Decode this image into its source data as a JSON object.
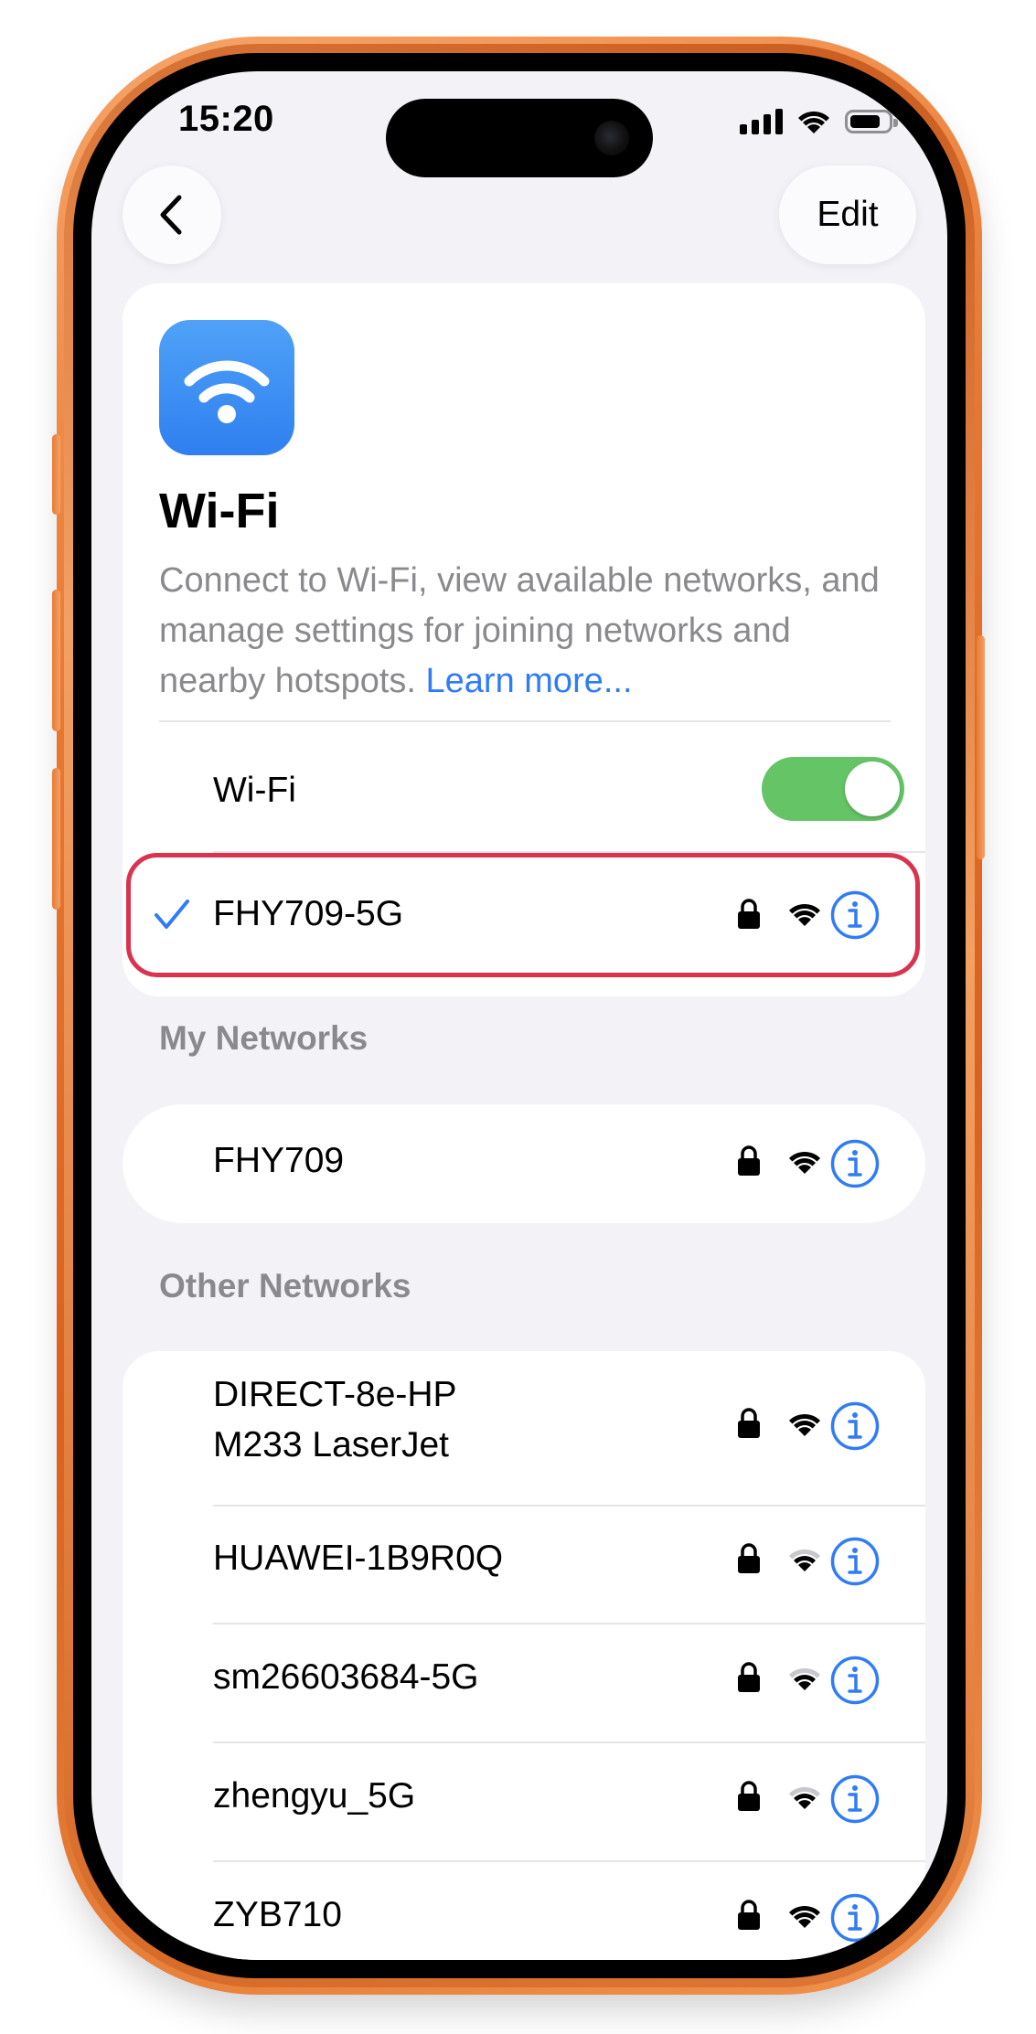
{
  "status_bar": {
    "time": "15:20"
  },
  "nav": {
    "edit_label": "Edit"
  },
  "header": {
    "title": "Wi-Fi",
    "description": "Connect to Wi-Fi, view available networks, and manage settings for joining networks and nearby hotspots.",
    "learn_more": "Learn more..."
  },
  "wifi_toggle": {
    "label": "Wi-Fi",
    "on": true
  },
  "connected_network": {
    "name": "FHY709-5G",
    "secured": true,
    "signal": "full"
  },
  "my_networks": {
    "header": "My Networks",
    "items": [
      {
        "name": "FHY709",
        "secured": true,
        "signal": "full"
      }
    ]
  },
  "other_networks": {
    "header": "Other Networks",
    "items": [
      {
        "name_line1": "DIRECT-8e-HP",
        "name_line2": "M233 LaserJet",
        "secured": true,
        "signal": "full"
      },
      {
        "name": "HUAWEI-1B9R0Q",
        "secured": true,
        "signal": "weak"
      },
      {
        "name": "sm26603684-5G",
        "secured": true,
        "signal": "weak"
      },
      {
        "name": "zhengyu_5G",
        "secured": true,
        "signal": "weak"
      },
      {
        "name": "ZYB710",
        "secured": true,
        "signal": "full"
      }
    ]
  },
  "colors": {
    "accent": "#2f7cf6",
    "toggle_on": "#65c466",
    "highlight": "#d9334f",
    "phone_frame": "#e8772f"
  },
  "icons": [
    "back-chevron-icon",
    "wifi-app-icon",
    "checkmark-icon",
    "lock-icon",
    "wifi-signal-icon",
    "info-icon"
  ]
}
